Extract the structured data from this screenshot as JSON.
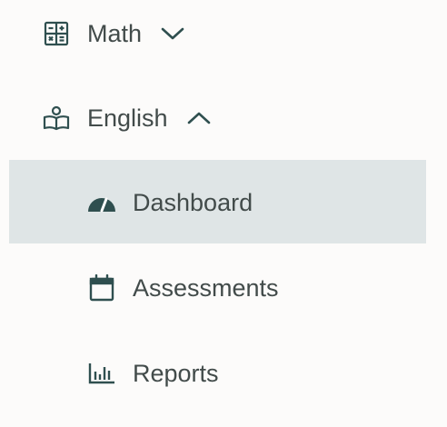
{
  "nav": {
    "items": [
      {
        "label": "Math",
        "icon": "calculator-icon",
        "expanded": false
      },
      {
        "label": "English",
        "icon": "open-book-icon",
        "expanded": true,
        "children": [
          {
            "label": "Dashboard",
            "icon": "dashboard-gauge-icon",
            "selected": true
          },
          {
            "label": "Assessments",
            "icon": "calendar-icon",
            "selected": false
          },
          {
            "label": "Reports",
            "icon": "bar-chart-icon",
            "selected": false
          }
        ]
      }
    ]
  },
  "colors": {
    "background": "#fcfbfa",
    "selected_background": "#dfe5e6",
    "icon": "#2f4f4f",
    "text": "#424b4a"
  }
}
